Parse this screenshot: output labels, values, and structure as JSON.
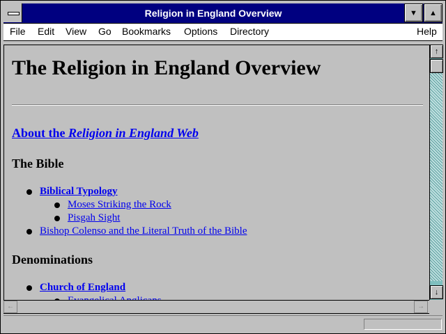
{
  "window": {
    "title": "Religion in England Overview",
    "buttons": {
      "system": "system-menu",
      "minimize": "▼",
      "maximize": "▲"
    }
  },
  "menu": {
    "items": [
      "File",
      "Edit",
      "View",
      "Go",
      "Bookmarks",
      "Options",
      "Directory"
    ],
    "help": "Help"
  },
  "page": {
    "heading": "The Religion in England Overview",
    "about_prefix": "About the ",
    "about_italic": "Religion in England Web",
    "sections": [
      {
        "title": "The Bible",
        "items": [
          {
            "label": "Biblical Typology",
            "bold": true
          },
          {
            "label": "Moses Striking the Rock",
            "bold": false
          },
          {
            "label": "Pisgah Sight",
            "bold": false
          },
          {
            "label": "Bishop Colenso and the Literal Truth of the Bible",
            "bold": false
          }
        ]
      },
      {
        "title": "Denominations",
        "items": [
          {
            "label": "Church of England",
            "bold": true
          },
          {
            "label": "Evangelical Anglicans",
            "bold": false
          }
        ]
      }
    ]
  },
  "scrollbar": {
    "up": "↑",
    "down": "↓",
    "left": "←",
    "right": "→"
  },
  "colors": {
    "titlebar": "#000080",
    "link": "#0000ee",
    "background": "#c0c0c0",
    "scroll_track": "#7fbfbf"
  }
}
